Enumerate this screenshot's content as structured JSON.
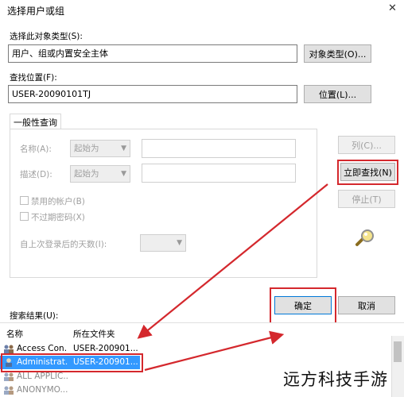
{
  "dialog": {
    "title": "选择用户或组",
    "close_glyph": "✕"
  },
  "object_type": {
    "label": "选择此对象类型(S):",
    "value": "用户、组或内置安全主体",
    "button": "对象类型(O)..."
  },
  "location": {
    "label": "查找位置(F):",
    "value": "USER-20090101TJ",
    "button": "位置(L)..."
  },
  "query": {
    "tab": "一般性查询",
    "name_label": "名称(A):",
    "name_mode": "起始为",
    "desc_label": "描述(D):",
    "desc_mode": "起始为",
    "disabled_accounts": "禁用的帐户(B)",
    "no_expire_password": "不过期密码(X)",
    "days_label": "自上次登录后的天数(I):"
  },
  "actions": {
    "columns": "列(C)...",
    "find_now": "立即查找(N)",
    "stop": "停止(T)",
    "ok": "确定",
    "cancel": "取消"
  },
  "results": {
    "label": "搜索结果(U):",
    "columns": [
      "名称",
      "所在文件夹"
    ],
    "rows": [
      {
        "name": "Access Con...",
        "folder": "USER-200901..."
      },
      {
        "name": "Administrat...",
        "folder": "USER-200901..."
      },
      {
        "name": "ALL APPLIC...",
        "folder": ""
      },
      {
        "name": "ANONYMO...",
        "folder": ""
      }
    ]
  },
  "watermark": "远方科技手游",
  "colors": {
    "highlight": "#d4282d",
    "selection": "#3399ff"
  }
}
